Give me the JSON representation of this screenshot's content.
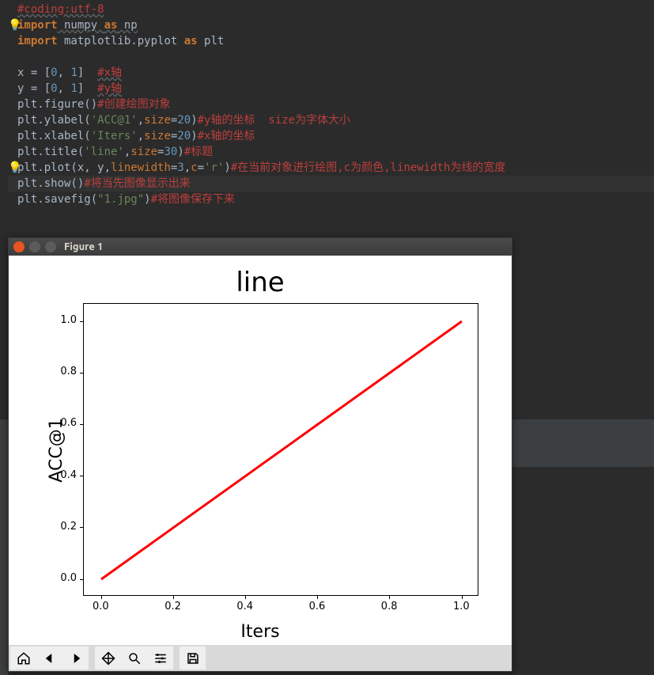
{
  "code": {
    "l1": "#coding:utf-8",
    "l2_import": "import",
    "l2_rest": " numpy ",
    "l2_as": "as",
    "l2_np": " np",
    "l3_import": "import",
    "l3_rest": " matplotlib.pyplot ",
    "l3_as": "as",
    "l3_plt": " plt",
    "l5_x": "x ",
    "l5_eq": "= [",
    "l5_n0": "0",
    "l5_c": ", ",
    "l5_n1": "1",
    "l5_close": "]  ",
    "l5_comment": "#x轴",
    "l6_y": "y ",
    "l6_eq": "= [",
    "l6_n0": "0",
    "l6_c": ", ",
    "l6_n1": "1",
    "l6_close": "]  ",
    "l6_comment": "#y轴",
    "l7": "plt.figure()",
    "l7_comment": "#创建绘图对象",
    "l8a": "plt.ylabel(",
    "l8_str": "'ACC@1'",
    "l8b": ",",
    "l8_size": "size",
    "l8_eq": "=",
    "l8_n": "20",
    "l8c": ")",
    "l8_comment": "#y轴的坐标  size为字体大小",
    "l9a": "plt.xlabel(",
    "l9_str": "'Iters'",
    "l9b": ",",
    "l9_size": "size",
    "l9_eq": "=",
    "l9_n": "20",
    "l9c": ")",
    "l9_comment": "#x轴的坐标",
    "l10a": "plt.title(",
    "l10_str": "'line'",
    "l10b": ",",
    "l10_size": "size",
    "l10_eq": "=",
    "l10_n": "30",
    "l10c": ")",
    "l10_comment": "#标题",
    "l11a": "plt.plot(x, y,",
    "l11_lw": "linewidth",
    "l11_eq1": "=",
    "l11_n": "3",
    "l11_c": ",",
    "l11_col": "c",
    "l11_eq2": "=",
    "l11_str": "'r'",
    "l11b": ")",
    "l11_comment": "#在当前对象进行绘图,c为颜色,linewidth为线的宽度",
    "l12": "plt.show()",
    "l12_comment": "#将当先图像显示出来",
    "l13a": "plt.savefig(",
    "l13_str": "\"1.jpg\"",
    "l13b": ")",
    "l13_comment": "#将图像保存下来"
  },
  "figure": {
    "window_title": "Figure 1",
    "toolbar_icons": [
      "home",
      "back",
      "forward",
      "pan",
      "zoom",
      "config",
      "save"
    ]
  },
  "chart_data": {
    "type": "line",
    "title": "line",
    "xlabel": "Iters",
    "ylabel": "ACC@1",
    "x": [
      0,
      1
    ],
    "y": [
      0,
      1
    ],
    "xlim": [
      0,
      1
    ],
    "ylim": [
      0,
      1
    ],
    "xticks": [
      0.0,
      0.2,
      0.4,
      0.6,
      0.8,
      1.0
    ],
    "yticks": [
      0.0,
      0.2,
      0.4,
      0.6,
      0.8,
      1.0
    ],
    "line_color": "#ff0000",
    "line_width": 3
  }
}
